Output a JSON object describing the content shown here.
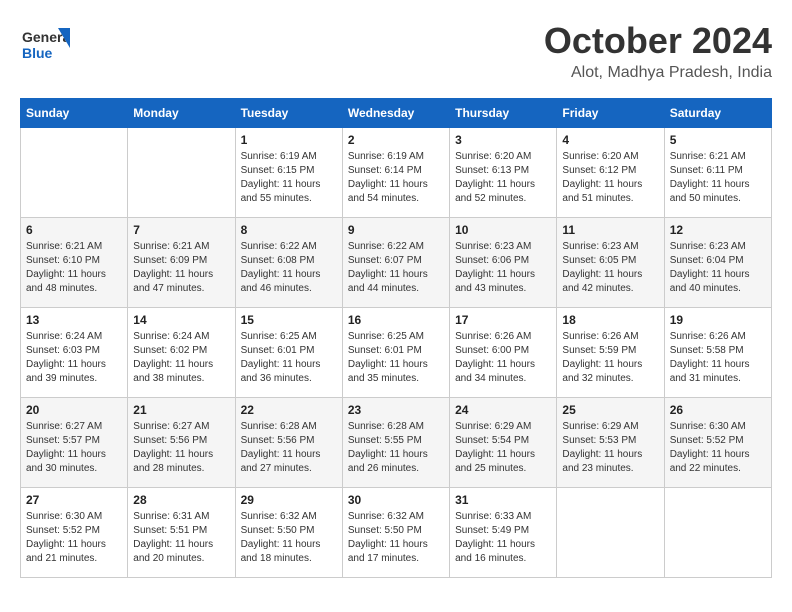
{
  "logo": {
    "line1": "General",
    "line2": "Blue"
  },
  "title": "October 2024",
  "location": "Alot, Madhya Pradesh, India",
  "weekdays": [
    "Sunday",
    "Monday",
    "Tuesday",
    "Wednesday",
    "Thursday",
    "Friday",
    "Saturday"
  ],
  "weeks": [
    [
      {
        "day": "",
        "info": ""
      },
      {
        "day": "",
        "info": ""
      },
      {
        "day": "1",
        "info": "Sunrise: 6:19 AM\nSunset: 6:15 PM\nDaylight: 11 hours and 55 minutes."
      },
      {
        "day": "2",
        "info": "Sunrise: 6:19 AM\nSunset: 6:14 PM\nDaylight: 11 hours and 54 minutes."
      },
      {
        "day": "3",
        "info": "Sunrise: 6:20 AM\nSunset: 6:13 PM\nDaylight: 11 hours and 52 minutes."
      },
      {
        "day": "4",
        "info": "Sunrise: 6:20 AM\nSunset: 6:12 PM\nDaylight: 11 hours and 51 minutes."
      },
      {
        "day": "5",
        "info": "Sunrise: 6:21 AM\nSunset: 6:11 PM\nDaylight: 11 hours and 50 minutes."
      }
    ],
    [
      {
        "day": "6",
        "info": "Sunrise: 6:21 AM\nSunset: 6:10 PM\nDaylight: 11 hours and 48 minutes."
      },
      {
        "day": "7",
        "info": "Sunrise: 6:21 AM\nSunset: 6:09 PM\nDaylight: 11 hours and 47 minutes."
      },
      {
        "day": "8",
        "info": "Sunrise: 6:22 AM\nSunset: 6:08 PM\nDaylight: 11 hours and 46 minutes."
      },
      {
        "day": "9",
        "info": "Sunrise: 6:22 AM\nSunset: 6:07 PM\nDaylight: 11 hours and 44 minutes."
      },
      {
        "day": "10",
        "info": "Sunrise: 6:23 AM\nSunset: 6:06 PM\nDaylight: 11 hours and 43 minutes."
      },
      {
        "day": "11",
        "info": "Sunrise: 6:23 AM\nSunset: 6:05 PM\nDaylight: 11 hours and 42 minutes."
      },
      {
        "day": "12",
        "info": "Sunrise: 6:23 AM\nSunset: 6:04 PM\nDaylight: 11 hours and 40 minutes."
      }
    ],
    [
      {
        "day": "13",
        "info": "Sunrise: 6:24 AM\nSunset: 6:03 PM\nDaylight: 11 hours and 39 minutes."
      },
      {
        "day": "14",
        "info": "Sunrise: 6:24 AM\nSunset: 6:02 PM\nDaylight: 11 hours and 38 minutes."
      },
      {
        "day": "15",
        "info": "Sunrise: 6:25 AM\nSunset: 6:01 PM\nDaylight: 11 hours and 36 minutes."
      },
      {
        "day": "16",
        "info": "Sunrise: 6:25 AM\nSunset: 6:01 PM\nDaylight: 11 hours and 35 minutes."
      },
      {
        "day": "17",
        "info": "Sunrise: 6:26 AM\nSunset: 6:00 PM\nDaylight: 11 hours and 34 minutes."
      },
      {
        "day": "18",
        "info": "Sunrise: 6:26 AM\nSunset: 5:59 PM\nDaylight: 11 hours and 32 minutes."
      },
      {
        "day": "19",
        "info": "Sunrise: 6:26 AM\nSunset: 5:58 PM\nDaylight: 11 hours and 31 minutes."
      }
    ],
    [
      {
        "day": "20",
        "info": "Sunrise: 6:27 AM\nSunset: 5:57 PM\nDaylight: 11 hours and 30 minutes."
      },
      {
        "day": "21",
        "info": "Sunrise: 6:27 AM\nSunset: 5:56 PM\nDaylight: 11 hours and 28 minutes."
      },
      {
        "day": "22",
        "info": "Sunrise: 6:28 AM\nSunset: 5:56 PM\nDaylight: 11 hours and 27 minutes."
      },
      {
        "day": "23",
        "info": "Sunrise: 6:28 AM\nSunset: 5:55 PM\nDaylight: 11 hours and 26 minutes."
      },
      {
        "day": "24",
        "info": "Sunrise: 6:29 AM\nSunset: 5:54 PM\nDaylight: 11 hours and 25 minutes."
      },
      {
        "day": "25",
        "info": "Sunrise: 6:29 AM\nSunset: 5:53 PM\nDaylight: 11 hours and 23 minutes."
      },
      {
        "day": "26",
        "info": "Sunrise: 6:30 AM\nSunset: 5:52 PM\nDaylight: 11 hours and 22 minutes."
      }
    ],
    [
      {
        "day": "27",
        "info": "Sunrise: 6:30 AM\nSunset: 5:52 PM\nDaylight: 11 hours and 21 minutes."
      },
      {
        "day": "28",
        "info": "Sunrise: 6:31 AM\nSunset: 5:51 PM\nDaylight: 11 hours and 20 minutes."
      },
      {
        "day": "29",
        "info": "Sunrise: 6:32 AM\nSunset: 5:50 PM\nDaylight: 11 hours and 18 minutes."
      },
      {
        "day": "30",
        "info": "Sunrise: 6:32 AM\nSunset: 5:50 PM\nDaylight: 11 hours and 17 minutes."
      },
      {
        "day": "31",
        "info": "Sunrise: 6:33 AM\nSunset: 5:49 PM\nDaylight: 11 hours and 16 minutes."
      },
      {
        "day": "",
        "info": ""
      },
      {
        "day": "",
        "info": ""
      }
    ]
  ]
}
